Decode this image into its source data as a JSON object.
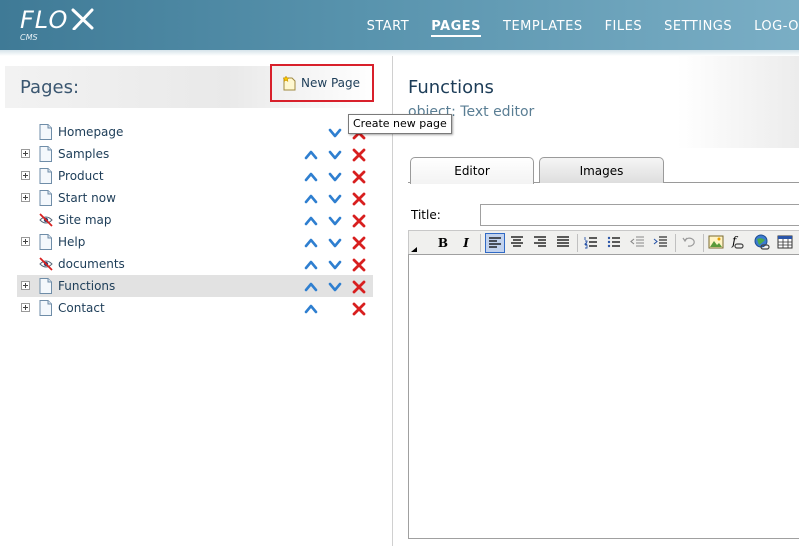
{
  "app": {
    "logo_text": "FLO",
    "logo_sub": "CMS"
  },
  "nav": {
    "items": [
      "START",
      "PAGES",
      "TEMPLATES",
      "FILES",
      "SETTINGS",
      "LOG-O"
    ],
    "active": "PAGES"
  },
  "left": {
    "title": "Pages:",
    "new_page_label": "New Page",
    "tooltip": "Create new page"
  },
  "tree": {
    "rows": [
      {
        "label": "Homepage",
        "expandable": false,
        "icon": "page-icon",
        "up": false,
        "down": true,
        "delete": true
      },
      {
        "label": "Samples",
        "expandable": true,
        "icon": "page-icon",
        "up": true,
        "down": true,
        "delete": true
      },
      {
        "label": "Product",
        "expandable": true,
        "icon": "page-icon",
        "up": true,
        "down": true,
        "delete": true
      },
      {
        "label": "Start now",
        "expandable": true,
        "icon": "page-icon",
        "up": true,
        "down": true,
        "delete": true
      },
      {
        "label": "Site map",
        "expandable": false,
        "icon": "hidden-page-icon",
        "up": true,
        "down": true,
        "delete": true
      },
      {
        "label": "Help",
        "expandable": true,
        "icon": "page-icon",
        "up": true,
        "down": true,
        "delete": true
      },
      {
        "label": "documents",
        "expandable": false,
        "icon": "hidden-page-icon",
        "up": true,
        "down": true,
        "delete": true
      },
      {
        "label": "Functions",
        "expandable": true,
        "icon": "page-icon",
        "up": true,
        "down": true,
        "delete": true,
        "selected": true
      },
      {
        "label": "Contact",
        "expandable": true,
        "icon": "page-icon",
        "up": true,
        "down": false,
        "delete": true
      }
    ]
  },
  "right": {
    "title": "Functions",
    "subtitle": "object: Text editor",
    "tabs": [
      "Editor",
      "Images"
    ],
    "active_tab": "Editor",
    "title_field_label": "Title:",
    "title_field_value": ""
  },
  "toolbar": {
    "bold": "B",
    "italic": "I",
    "buttons": [
      "bold-icon",
      "italic-icon",
      "align-left-icon",
      "align-center-icon",
      "align-right-icon",
      "align-justify-icon",
      "ordered-list-icon",
      "unordered-list-icon",
      "outdent-icon",
      "indent-icon",
      "undo-icon",
      "image-icon",
      "link-icon",
      "globe-link-icon",
      "table-icon"
    ]
  },
  "colors": {
    "header": "#4f8aa6",
    "highlight_border": "#d8202b",
    "text": "#1d3d58",
    "arrow": "#2f7fd0",
    "delete": "#d81f1f"
  }
}
